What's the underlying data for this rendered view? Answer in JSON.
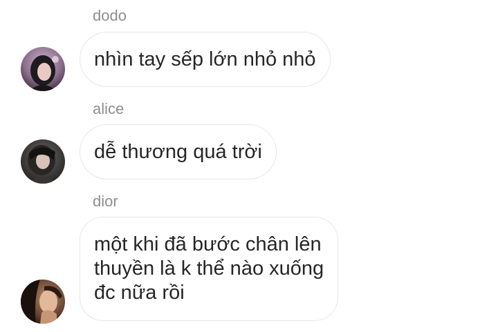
{
  "messages": [
    {
      "sender": "dodo",
      "text": "nhìn tay sếp lớn nhỏ nhỏ",
      "avatar_icon": "user-avatar-photo"
    },
    {
      "sender": "alice",
      "text": "dễ thương quá trời",
      "avatar_icon": "user-avatar-photo"
    },
    {
      "sender": "dior",
      "lines": [
        "một khi đã bước chân lên",
        "thuyền là k thể nào xuống",
        "đc nữa rồi"
      ],
      "avatar_icon": "user-avatar-photo"
    }
  ],
  "colors": {
    "sender_name": "#8e8e8e",
    "bubble_border": "#e6e6e6",
    "message_text": "#262626",
    "background": "#ffffff"
  }
}
